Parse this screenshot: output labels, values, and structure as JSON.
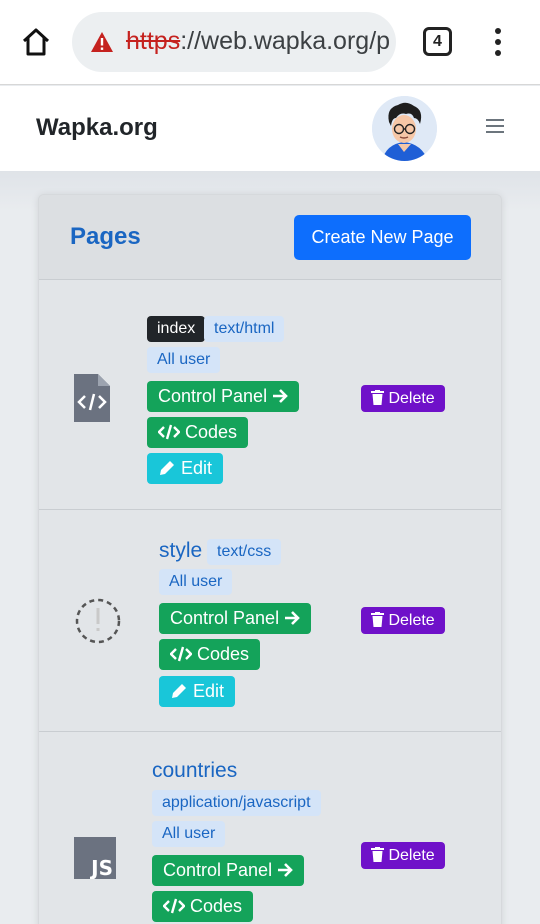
{
  "browser": {
    "url_protocol": "https",
    "url_rest": "://web.wapka.org/p",
    "tab_count": "4",
    "home_icon": "home-icon",
    "warning_icon": "warning-triangle-icon",
    "menu_icon": "vertical-dots-icon"
  },
  "navbar": {
    "brand": "Wapka.org",
    "menu_icon": "hamburger-icon"
  },
  "card": {
    "title": "Pages",
    "create_button": "Create New Page"
  },
  "pages": [
    {
      "label": "index",
      "name": "",
      "type": "text/html",
      "access": "All user",
      "icon": "html-file-icon",
      "control_panel": "Control Panel",
      "codes": "Codes",
      "edit": "Edit",
      "delete": "Delete"
    },
    {
      "label": "",
      "name": "style",
      "type": "text/css",
      "access": "All user",
      "icon": "missing-image-icon",
      "control_panel": "Control Panel",
      "codes": "Codes",
      "edit": "Edit",
      "delete": "Delete"
    },
    {
      "label": "",
      "name": "countries",
      "type": "application/javascript",
      "access": "All user",
      "icon": "js-file-icon",
      "control_panel": "Control Panel",
      "codes": "Codes",
      "edit": "",
      "delete": "Delete"
    }
  ],
  "colors": {
    "primary": "#0d6efd",
    "success": "#14a35a",
    "info": "#19c6d9",
    "danger_purple": "#6f11c9",
    "link": "#1a66c2"
  }
}
